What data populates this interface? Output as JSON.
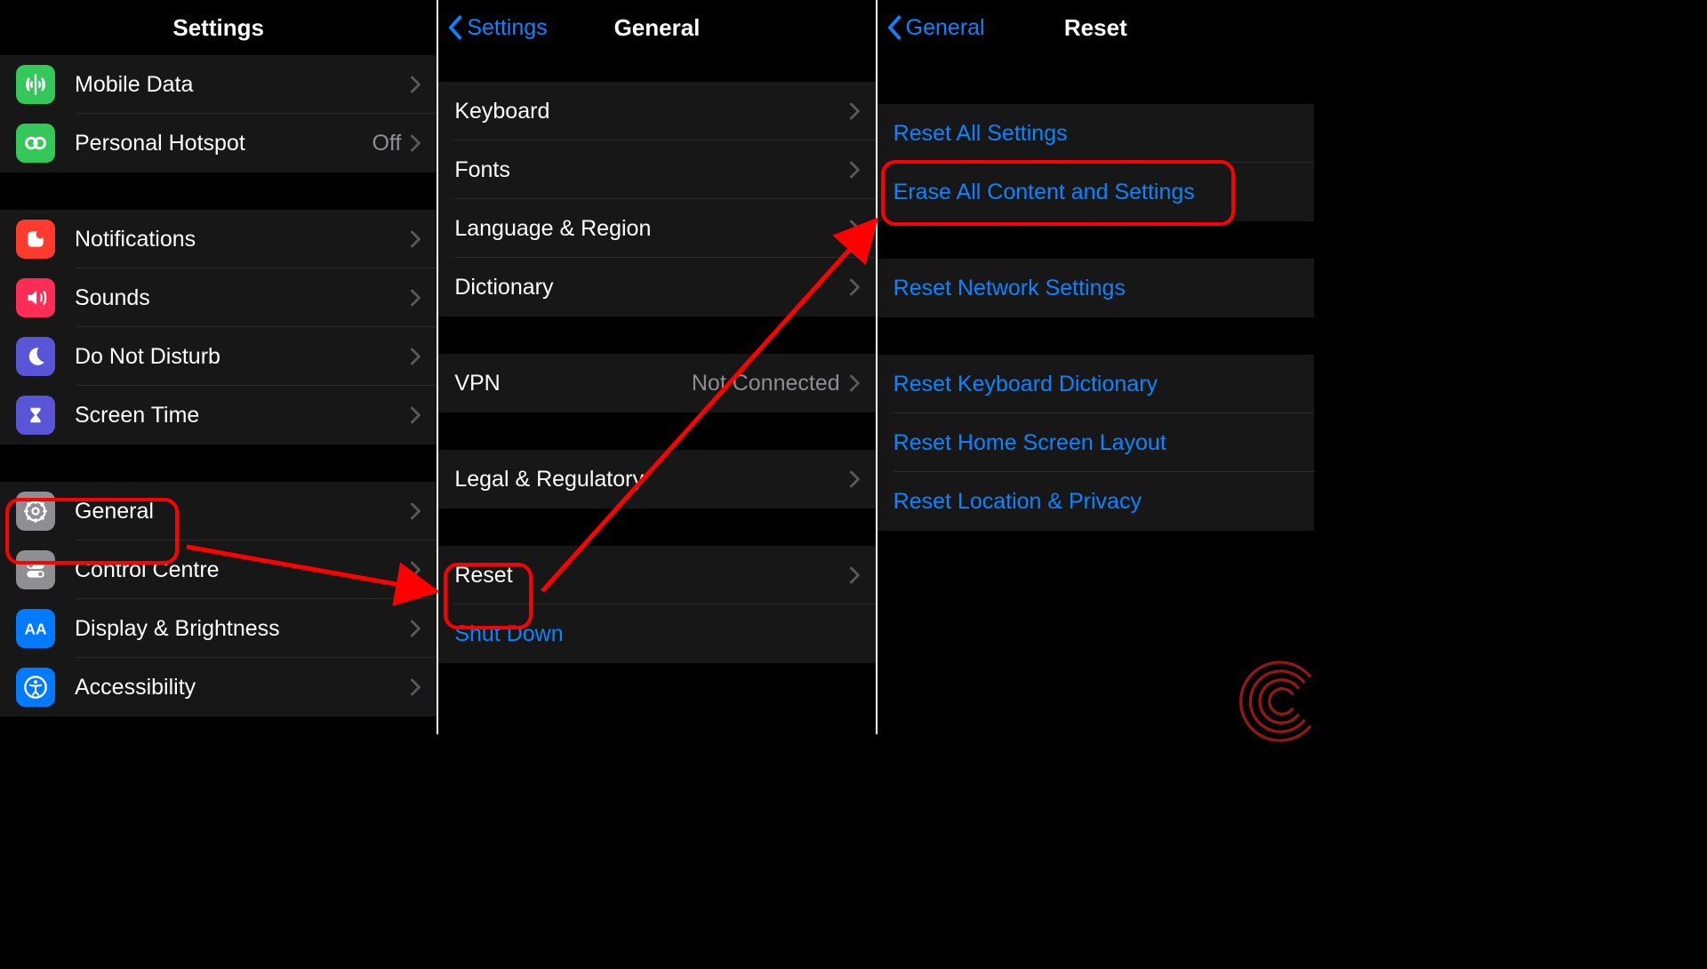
{
  "panels": {
    "settings": {
      "title": "Settings",
      "items": {
        "mobile_data": "Mobile Data",
        "personal_hotspot": "Personal Hotspot",
        "personal_hotspot_status": "Off",
        "notifications": "Notifications",
        "sounds": "Sounds",
        "dnd": "Do Not Disturb",
        "screen_time": "Screen Time",
        "general": "General",
        "control_centre": "Control Centre",
        "display": "Display & Brightness",
        "accessibility": "Accessibility"
      }
    },
    "general": {
      "title": "General",
      "back": "Settings",
      "items": {
        "keyboard": "Keyboard",
        "fonts": "Fonts",
        "language": "Language & Region",
        "dictionary": "Dictionary",
        "vpn": "VPN",
        "vpn_status": "Not Connected",
        "legal": "Legal & Regulatory",
        "reset": "Reset",
        "shutdown": "Shut Down"
      }
    },
    "reset": {
      "title": "Reset",
      "back": "General",
      "items": {
        "reset_all": "Reset All Settings",
        "erase_all": "Erase All Content and Settings",
        "reset_network": "Reset Network Settings",
        "reset_keyboard": "Reset Keyboard Dictionary",
        "reset_home": "Reset Home Screen Layout",
        "reset_location": "Reset Location & Privacy"
      }
    }
  }
}
